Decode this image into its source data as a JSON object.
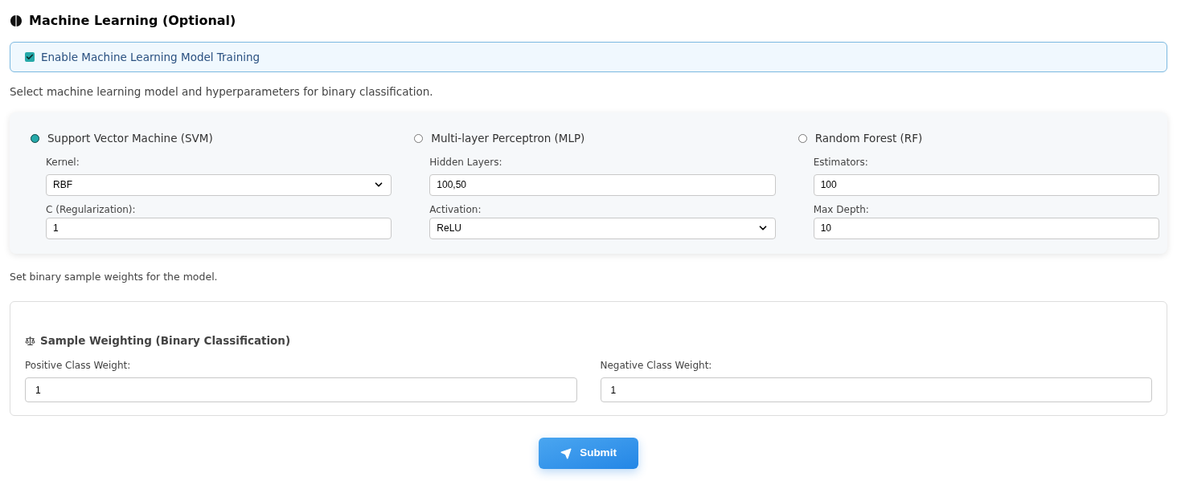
{
  "section_title": "Machine Learning (Optional)",
  "enable": {
    "label": "Enable Machine Learning Model Training",
    "checked": true
  },
  "model_hint": "Select machine learning model and hyperparameters for binary classification.",
  "models": [
    {
      "name": "Support Vector Machine (SVM)",
      "selected": true,
      "fields": [
        {
          "kind": "select",
          "label": "Kernel:",
          "value": "RBF"
        },
        {
          "kind": "input",
          "label": "C (Regularization):",
          "value": "1"
        }
      ]
    },
    {
      "name": "Multi-layer Perceptron (MLP)",
      "selected": false,
      "fields": [
        {
          "kind": "input",
          "label": "Hidden Layers:",
          "value": "100,50"
        },
        {
          "kind": "select",
          "label": "Activation:",
          "value": "ReLU"
        }
      ]
    },
    {
      "name": "Random Forest (RF)",
      "selected": false,
      "fields": [
        {
          "kind": "input",
          "label": "Estimators:",
          "value": "100"
        },
        {
          "kind": "input",
          "label": "Max Depth:",
          "value": "10"
        }
      ]
    }
  ],
  "weights_hint": "Set binary sample weights for the model.",
  "weighting": {
    "title": "Sample Weighting (Binary Classification)",
    "fields": [
      {
        "label": "Positive Class Weight:",
        "value": "1"
      },
      {
        "label": "Negative Class Weight:",
        "value": "1"
      }
    ]
  },
  "submit": "Submit"
}
